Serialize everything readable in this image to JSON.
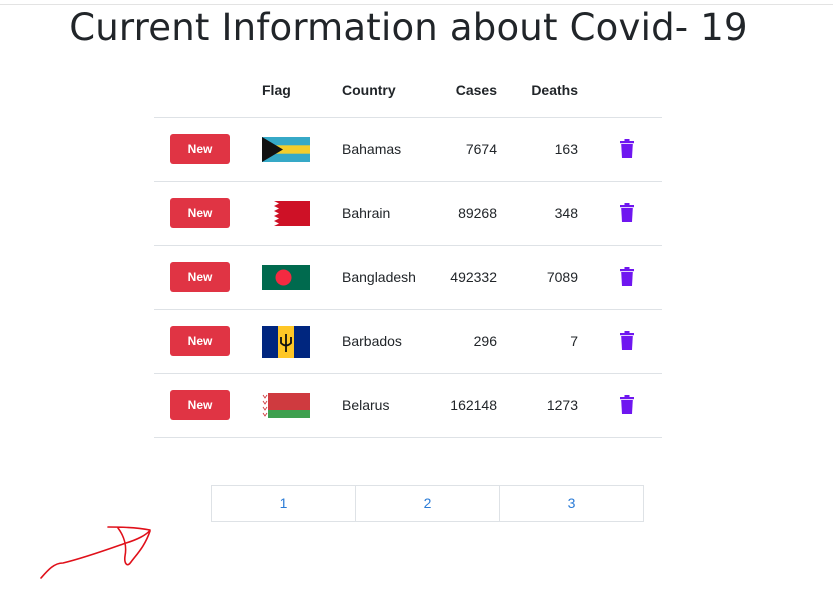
{
  "page": {
    "title": "Current Information about Covid- 19"
  },
  "table": {
    "headers": {
      "flag": "Flag",
      "country": "Country",
      "cases": "Cases",
      "deaths": "Deaths"
    },
    "new_label": "New",
    "rows": [
      {
        "country": "Bahamas",
        "cases": "7674",
        "deaths": "163",
        "flag_icon": "bahamas-flag-icon"
      },
      {
        "country": "Bahrain",
        "cases": "89268",
        "deaths": "348",
        "flag_icon": "bahrain-flag-icon"
      },
      {
        "country": "Bangladesh",
        "cases": "492332",
        "deaths": "7089",
        "flag_icon": "bangladesh-flag-icon"
      },
      {
        "country": "Barbados",
        "cases": "296",
        "deaths": "7",
        "flag_icon": "barbados-flag-icon"
      },
      {
        "country": "Belarus",
        "cases": "162148",
        "deaths": "1273",
        "flag_icon": "belarus-flag-icon"
      }
    ]
  },
  "pagination": {
    "pages": [
      "1",
      "2",
      "3"
    ]
  },
  "colors": {
    "new_button": "#e03444",
    "trash_icon": "#6f16f0",
    "page_link": "#2a7bd6",
    "annotation": "#e0101a"
  }
}
